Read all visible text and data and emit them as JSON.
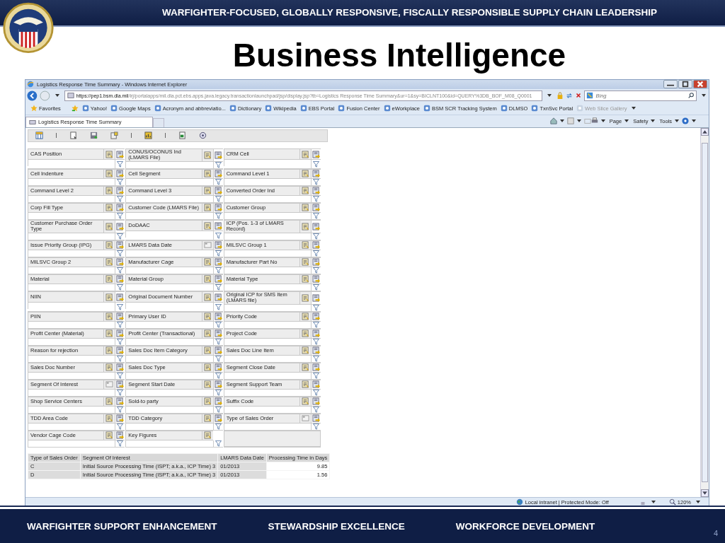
{
  "slide": {
    "header": "WARFIGHTER-FOCUSED, GLOBALLY RESPONSIVE, FISCALLY RESPONSIBLE SUPPLY CHAIN LEADERSHIP",
    "title": "Business Intelligence",
    "footer": [
      "WARFIGHTER SUPPORT ENHANCEMENT",
      "STEWARDSHIP EXCELLENCE",
      "WORKFORCE DEVELOPMENT"
    ],
    "page_number": "4"
  },
  "window": {
    "title": "Logistics Response Time Summary - Windows Internet Explorer"
  },
  "address_bar": {
    "host": "https://pep1.bsm.dla.mil",
    "path": "/irj/portalapps/mil.dla.pct.ebs.apps.java.legacy.transactionlaunchpad/jsp/display.jsp?tb=Logistics Response Time Summary&ur=1&sy=BICLNT100&id=QUERY%3DB_BOF_M08_Q0001"
  },
  "search": {
    "placeholder": "Bing"
  },
  "favorites_bar": {
    "label": "Favorites",
    "items": [
      {
        "label": "Yahoo!",
        "disabled": false
      },
      {
        "label": "Google Maps",
        "disabled": false
      },
      {
        "label": "Acronym and abbreviatio...",
        "disabled": false
      },
      {
        "label": "Dictionary",
        "disabled": false
      },
      {
        "label": "Wikipedia",
        "disabled": false
      },
      {
        "label": "EBS Portal",
        "disabled": false
      },
      {
        "label": "Fusion Center",
        "disabled": false
      },
      {
        "label": "eWorkplace",
        "disabled": false
      },
      {
        "label": "BSM SCR Tracking System",
        "disabled": false
      },
      {
        "label": "DLMSO",
        "disabled": false
      },
      {
        "label": "TxnSvc Portal",
        "disabled": false
      },
      {
        "label": "Web Slice Gallery",
        "disabled": true
      }
    ]
  },
  "tabs": [
    {
      "label": "Logistics Response Time Summary",
      "selected": true
    }
  ],
  "command_bar": [
    "Page",
    "Safety",
    "Tools"
  ],
  "field_rows": [
    [
      {
        "label": "CAS Position",
        "kind": "characteristic"
      },
      {
        "label": "CONUS/OCONUS Ind (LMARS File)",
        "kind": "characteristic"
      },
      {
        "label": "CRM Cell",
        "kind": "characteristic"
      }
    ],
    [
      {
        "label": "Cell Indenture",
        "kind": "characteristic"
      },
      {
        "label": "Cell Segment",
        "kind": "characteristic"
      },
      {
        "label": "Command Level 1",
        "kind": "characteristic"
      }
    ],
    [
      {
        "label": "Command Level 2",
        "kind": "characteristic"
      },
      {
        "label": "Command Level 3",
        "kind": "characteristic"
      },
      {
        "label": "Converted Order Ind",
        "kind": "characteristic"
      }
    ],
    [
      {
        "label": "Corp Fill Type",
        "kind": "characteristic"
      },
      {
        "label": "Customer Code (LMARS File)",
        "kind": "characteristic"
      },
      {
        "label": "Customer Group",
        "kind": "characteristic"
      }
    ],
    [
      {
        "label": "Customer Purchase Order Type",
        "kind": "characteristic"
      },
      {
        "label": "DoDAAC",
        "kind": "characteristic"
      },
      {
        "label": "ICP (Pos. 1-3 of LMARS Record)",
        "kind": "characteristic"
      }
    ],
    [
      {
        "label": "Issue Priority Group (IPG)",
        "kind": "characteristic"
      },
      {
        "label": "LMARS Data Date",
        "kind": "drilled"
      },
      {
        "label": "MILSVC Group 1",
        "kind": "characteristic"
      }
    ],
    [
      {
        "label": "MILSVC Group 2",
        "kind": "characteristic"
      },
      {
        "label": "Manufacturer Cage",
        "kind": "characteristic"
      },
      {
        "label": "Manufacturer Part No",
        "kind": "characteristic"
      }
    ],
    [
      {
        "label": "Material",
        "kind": "characteristic"
      },
      {
        "label": "Material Group",
        "kind": "characteristic"
      },
      {
        "label": "Material Type",
        "kind": "characteristic"
      }
    ],
    [
      {
        "label": "NIIN",
        "kind": "characteristic"
      },
      {
        "label": "Original Document Number",
        "kind": "characteristic"
      },
      {
        "label": "Original ICP for SMS Item (LMARS file)",
        "kind": "characteristic"
      }
    ],
    [
      {
        "label": "PIIN",
        "kind": "characteristic"
      },
      {
        "label": "Primary User ID",
        "kind": "characteristic"
      },
      {
        "label": "Priority Code",
        "kind": "characteristic"
      }
    ],
    [
      {
        "label": "Profit Center (Material)",
        "kind": "characteristic"
      },
      {
        "label": "Profit Center (Transactional)",
        "kind": "characteristic"
      },
      {
        "label": "Project Code",
        "kind": "characteristic"
      }
    ],
    [
      {
        "label": "Reason for rejection",
        "kind": "characteristic"
      },
      {
        "label": "Sales Doc Item Category",
        "kind": "characteristic"
      },
      {
        "label": "Sales Doc Line Item",
        "kind": "characteristic"
      }
    ],
    [
      {
        "label": "Sales Doc Number",
        "kind": "characteristic"
      },
      {
        "label": "Sales Doc Type",
        "kind": "characteristic"
      },
      {
        "label": "Segment Close Date",
        "kind": "characteristic"
      }
    ],
    [
      {
        "label": "Segment Of Interest",
        "kind": "drilled"
      },
      {
        "label": "Segment Start Date",
        "kind": "characteristic"
      },
      {
        "label": "Segment Support Team",
        "kind": "characteristic"
      }
    ],
    [
      {
        "label": "Shop Service Centers",
        "kind": "characteristic"
      },
      {
        "label": "Sold-to party",
        "kind": "characteristic"
      },
      {
        "label": "Suffix Code",
        "kind": "characteristic"
      }
    ],
    [
      {
        "label": "TDD Area Code",
        "kind": "characteristic"
      },
      {
        "label": "TDD Category",
        "kind": "characteristic"
      },
      {
        "label": "Type of Sales Order",
        "kind": "drilled"
      }
    ],
    [
      {
        "label": "Vendor Cage Code",
        "kind": "characteristic"
      },
      {
        "label": "Key Figures",
        "kind": "key_figures"
      }
    ]
  ],
  "result_table": {
    "columns": [
      "Type of Sales Order",
      "Segment Of Interest",
      "LMARS Data Date",
      "Processing Time in Days"
    ],
    "rows": [
      [
        "C",
        "Initial Source Processing Time (ISPT; a.k.a., ICP Time) 3",
        "01/2013",
        "9.85"
      ],
      [
        "D",
        "Initial Source Processing Time (ISPT; a.k.a., ICP Time) 3",
        "01/2013",
        "1.56"
      ]
    ]
  },
  "status_bar": {
    "zone": "Local intranet | Protected Mode: Off",
    "zoom": "120%"
  }
}
